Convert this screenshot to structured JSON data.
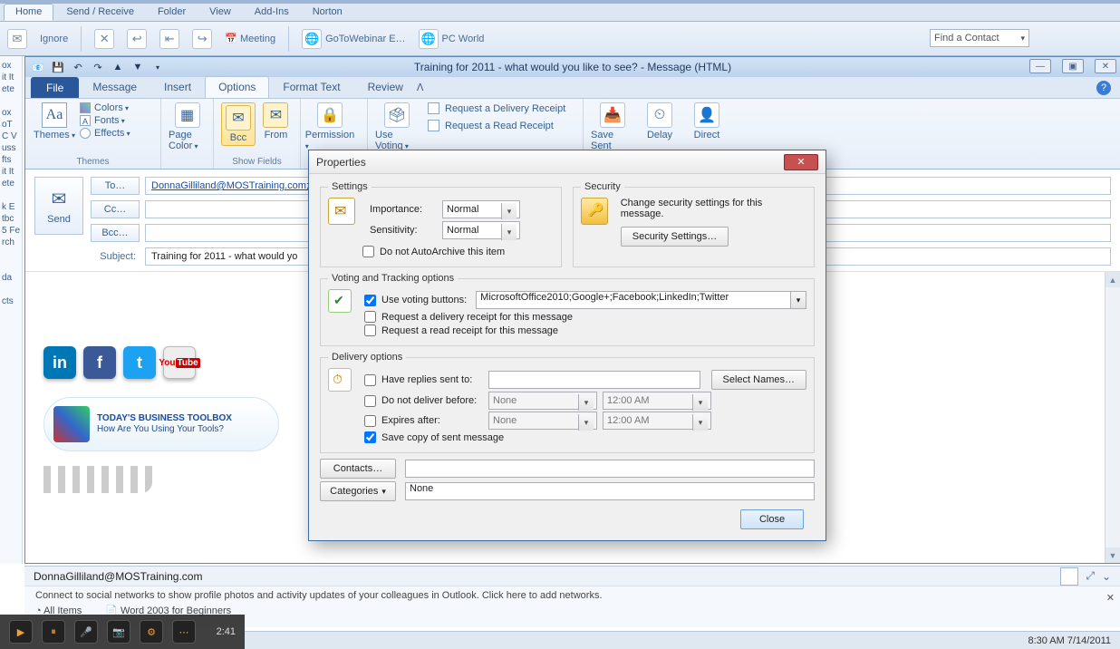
{
  "outlook": {
    "tabs": [
      "Home",
      "Send / Receive",
      "Folder",
      "View",
      "Add-Ins",
      "Norton"
    ],
    "activeTab": "Home",
    "ignore": "Ignore",
    "bookmarks": [
      "GoToWebinar E…",
      "PC World"
    ],
    "findContact": "Find a Contact"
  },
  "compose": {
    "title": "Training for 2011 - what would you like to see?  -  Message (HTML)",
    "tabs": {
      "file": "File",
      "message": "Message",
      "insert": "Insert",
      "options": "Options",
      "format": "Format Text",
      "review": "Review"
    },
    "ribbon": {
      "themes": {
        "label": "Themes",
        "colors": "Colors",
        "fonts": "Fonts",
        "effects": "Effects",
        "pageColor": "Page Color"
      },
      "showFields": {
        "label": "Show Fields",
        "bcc": "Bcc",
        "from": "From"
      },
      "permission": {
        "label": "Permission",
        "btn": "Permission"
      },
      "tracking": {
        "useVoting": "Use Voting",
        "reqDeliv": "Request a Delivery Receipt",
        "reqRead": "Request a Read Receipt"
      },
      "moreOptions": {
        "saveSent": "Save Sent",
        "delay": "Delay",
        "direct": "Direct"
      }
    },
    "fields": {
      "send": "Send",
      "to": "To…",
      "cc": "Cc…",
      "bcc": "Bcc…",
      "subject": "Subject:",
      "toValue": "DonnaGilliland@MOSTraining.com;",
      "ccValue": "",
      "bccValue": "",
      "subjectValue": "Training for 2011 - what would yo"
    },
    "bodyBanner": {
      "line1": "TODAY'S BUSINESS TOOLBOX",
      "line2": "How Are You Using Your Tools?"
    }
  },
  "properties": {
    "title": "Properties",
    "settings": {
      "legend": "Settings",
      "importance": "Importance:",
      "importanceVal": "Normal",
      "sensitivity": "Sensitivity:",
      "sensitivityVal": "Normal",
      "noArchive": "Do not AutoArchive this item"
    },
    "security": {
      "legend": "Security",
      "desc": "Change security settings for this message.",
      "btn": "Security Settings…"
    },
    "voting": {
      "legend": "Voting and Tracking options",
      "useVoting": "Use voting buttons:",
      "useVotingChecked": true,
      "votingValue": "MicrosoftOffice2010;Google+;Facebook;LinkedIn;Twitter",
      "reqDeliv": "Request a delivery receipt for this message",
      "reqRead": "Request a read receipt for this message"
    },
    "delivery": {
      "legend": "Delivery options",
      "replies": "Have replies sent to:",
      "selectNames": "Select Names…",
      "notBefore": "Do not deliver before:",
      "notBeforeDate": "None",
      "notBeforeTime": "12:00 AM",
      "expires": "Expires after:",
      "expiresDate": "None",
      "expiresTime": "12:00 AM",
      "saveCopy": "Save copy of sent message",
      "saveCopyChecked": true
    },
    "contacts": {
      "btn": "Contacts…",
      "val": ""
    },
    "categories": {
      "btn": "Categories",
      "val": "None"
    },
    "close": "Close"
  },
  "peoplePane": {
    "who": "DonnaGilliland@MOSTraining.com",
    "connect": "Connect to social networks to show profile photos and activity updates of your colleagues in Outlook. Click here to add networks.",
    "allItems": "All Items",
    "doc": "Word 2003 for Beginners",
    "time": "8:30 AM  7/14/2011"
  },
  "player": {
    "time": "2:41"
  }
}
